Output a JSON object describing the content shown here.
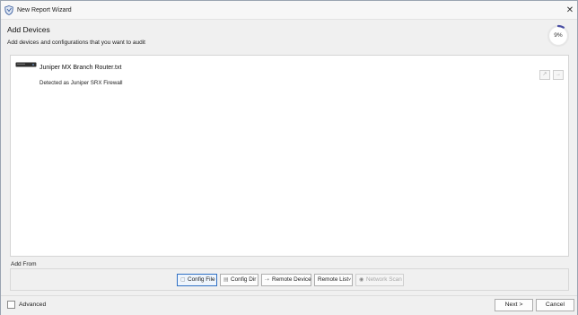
{
  "window": {
    "title": "New Report Wizard",
    "close_glyph": "✕"
  },
  "header": {
    "heading": "Add Devices",
    "subtitle": "Add devices and configurations that you want to audit",
    "progress_label": "9%",
    "progress_fraction": 0.09,
    "progress_color": "#4a4fa3"
  },
  "devices": [
    {
      "name": "Juniper MX Branch Router.txt",
      "detected": "Detected as Juniper SRX Firewall",
      "icon": "router-icon",
      "actions": [
        {
          "name": "edit-device-button",
          "glyph": "↗"
        },
        {
          "name": "remove-device-button",
          "glyph": "→"
        }
      ]
    }
  ],
  "add_from": {
    "label": "Add From",
    "buttons": [
      {
        "label": "Config File",
        "icon": "file-icon",
        "glyph": "▢",
        "state": "active"
      },
      {
        "label": "Config Dir",
        "icon": "folder-icon",
        "glyph": "▤",
        "state": "normal"
      },
      {
        "label": "Remote Device",
        "icon": "remote-device-icon",
        "glyph": "⇢",
        "state": "normal"
      },
      {
        "label": "Remote List",
        "icon": "dropdown-caret-icon",
        "glyph": "˅",
        "state": "normal"
      },
      {
        "label": "Network Scan",
        "icon": "network-scan-icon",
        "glyph": "◉",
        "state": "disabled"
      }
    ]
  },
  "footer": {
    "advanced_label": "Advanced",
    "advanced_checked": false,
    "next_label": "Next >",
    "cancel_label": "Cancel"
  },
  "colors": {
    "accent": "#2f6fc3",
    "window_bg": "#f0f0f0",
    "panel_bg": "#ffffff"
  }
}
